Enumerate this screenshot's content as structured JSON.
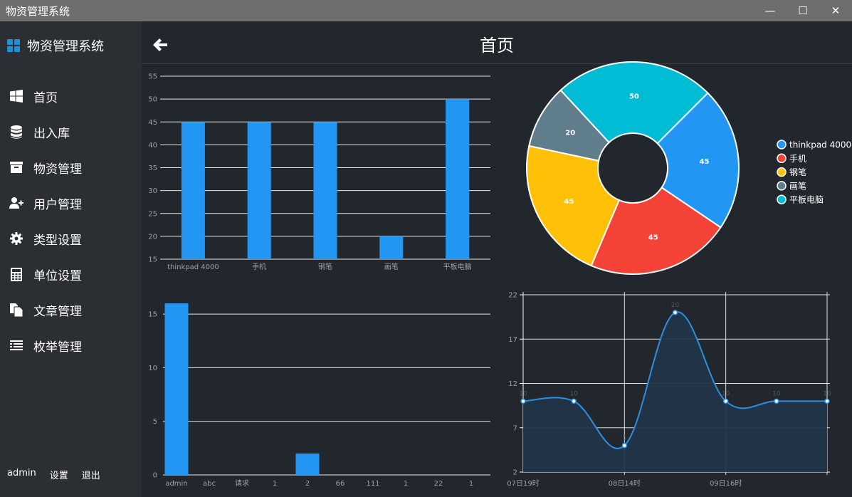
{
  "window": {
    "title": "物资管理系统",
    "minimize": "—",
    "maximize": "☐",
    "close": "✕"
  },
  "sidebar": {
    "brand": "物资管理系统",
    "items": [
      {
        "label": "首页",
        "icon": "windows-icon"
      },
      {
        "label": "出入库",
        "icon": "database-icon"
      },
      {
        "label": "物资管理",
        "icon": "archive-icon"
      },
      {
        "label": "用户管理",
        "icon": "user-plus-icon"
      },
      {
        "label": "类型设置",
        "icon": "gear-icon"
      },
      {
        "label": "单位设置",
        "icon": "calculator-icon"
      },
      {
        "label": "文章管理",
        "icon": "documents-icon"
      },
      {
        "label": "枚举管理",
        "icon": "list-icon"
      }
    ],
    "footer": {
      "user": "admin",
      "settings": "设置",
      "logout": "退出"
    }
  },
  "header": {
    "title": "首页"
  },
  "chart_data": [
    {
      "type": "bar",
      "categories": [
        "thinkpad 4000",
        "手机",
        "钢笔",
        "画笔",
        "平板电脑"
      ],
      "values": [
        45,
        45,
        45,
        20,
        50
      ],
      "ylim": [
        15,
        55
      ],
      "yticks": [
        15,
        20,
        25,
        30,
        35,
        40,
        45,
        50,
        55
      ],
      "grid": true,
      "color": "#2196f3"
    },
    {
      "type": "pie",
      "donut": true,
      "labels": [
        "thinkpad 4000",
        "手机",
        "钢笔",
        "画笔",
        "平板电脑"
      ],
      "values": [
        45,
        45,
        45,
        20,
        50
      ],
      "colors": [
        "#2196f3",
        "#f44336",
        "#ffc107",
        "#607d8b",
        "#00bcd4"
      ],
      "legend": "right"
    },
    {
      "type": "bar",
      "categories": [
        "admin",
        "abc",
        "请求",
        "1",
        "2",
        "66",
        "111",
        "1",
        "22",
        "1"
      ],
      "values": [
        16,
        0,
        0,
        0,
        2,
        0,
        0,
        0,
        0,
        0
      ],
      "ylim": [
        0,
        17
      ],
      "yticks": [
        0,
        5,
        10,
        15
      ],
      "grid": true,
      "color": "#2196f3"
    },
    {
      "type": "area",
      "x": [
        0,
        1,
        2,
        3,
        4,
        5,
        6
      ],
      "values": [
        10,
        10,
        5,
        20,
        10,
        10,
        10
      ],
      "point_labels": [
        "10",
        "10",
        "5",
        "20",
        "10",
        "10",
        "10"
      ],
      "xtick_labels": [
        {
          "at": 0,
          "label": "07日19时"
        },
        {
          "at": 2,
          "label": "08日14时"
        },
        {
          "at": 4,
          "label": "09日16时"
        }
      ],
      "ylim": [
        2,
        22
      ],
      "yticks": [
        2,
        7,
        12,
        17,
        22
      ],
      "grid": true,
      "line_color": "#2d8fe0",
      "fill_color": "#223549"
    }
  ]
}
